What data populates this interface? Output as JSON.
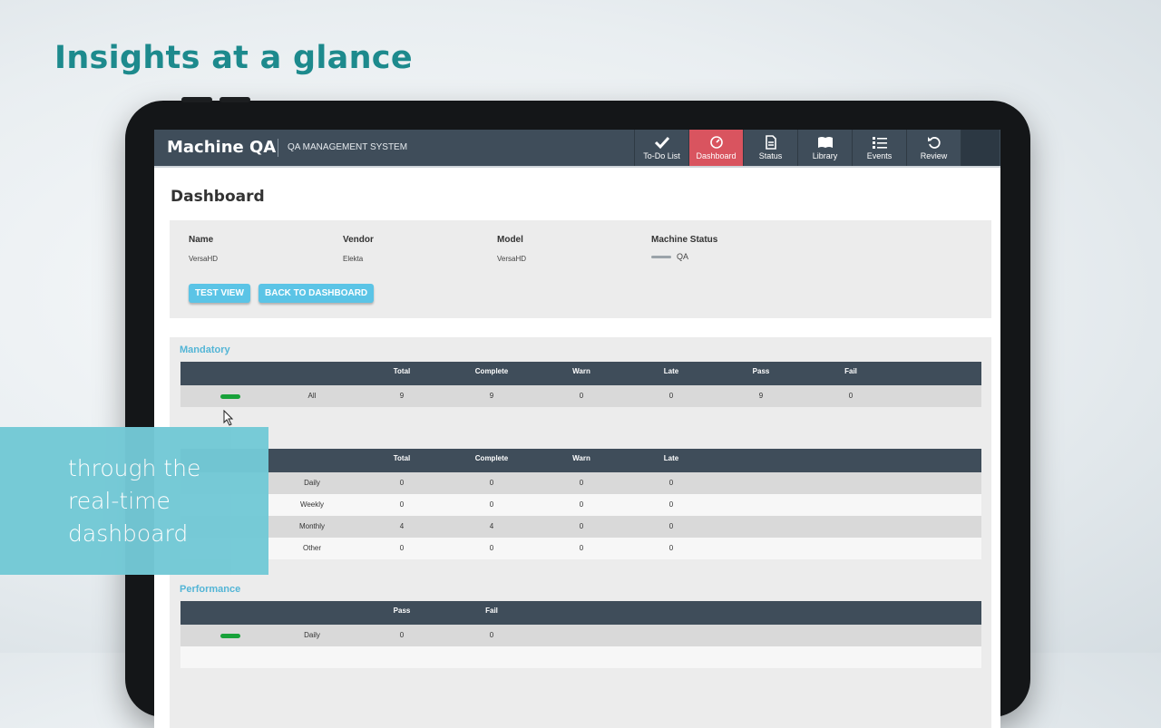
{
  "headline": "Insights at a glance",
  "app": {
    "brand": "Machine QA",
    "subtitle": "QA MANAGEMENT SYSTEM",
    "nav": [
      {
        "label": "To-Do List",
        "icon": "checkmark-icon"
      },
      {
        "label": "Dashboard",
        "icon": "gauge-icon",
        "active": true
      },
      {
        "label": "Status",
        "icon": "document-icon"
      },
      {
        "label": "Library",
        "icon": "book-icon"
      },
      {
        "label": "Events",
        "icon": "list-icon"
      },
      {
        "label": "Review",
        "icon": "undo-icon"
      }
    ]
  },
  "page": {
    "title": "Dashboard"
  },
  "machine": {
    "name_label": "Name",
    "name": "VersaHD",
    "vendor_label": "Vendor",
    "vendor": "Elekta",
    "model_label": "Model",
    "model": "VersaHD",
    "status_label": "Machine Status",
    "status": "QA"
  },
  "buttons": {
    "test_view": "TEST VIEW",
    "back": "BACK TO DASHBOARD"
  },
  "mandatory": {
    "title": "Mandatory",
    "headers": [
      "Total",
      "Complete",
      "Warn",
      "Late",
      "Pass",
      "Fail"
    ],
    "row": {
      "label": "All",
      "values": [
        "9",
        "9",
        "0",
        "0",
        "9",
        "0"
      ]
    }
  },
  "schedule": {
    "headers": [
      "Total",
      "Complete",
      "Warn",
      "Late"
    ],
    "rows": [
      {
        "label": "Daily",
        "values": [
          "0",
          "0",
          "0",
          "0"
        ]
      },
      {
        "label": "Weekly",
        "values": [
          "0",
          "0",
          "0",
          "0"
        ]
      },
      {
        "label": "Monthly",
        "values": [
          "4",
          "4",
          "0",
          "0"
        ]
      },
      {
        "label": "Other",
        "values": [
          "0",
          "0",
          "0",
          "0"
        ]
      }
    ]
  },
  "performance": {
    "title": "Performance",
    "headers": [
      "Pass",
      "Fail"
    ],
    "row": {
      "label": "Daily",
      "values": [
        "0",
        "0"
      ]
    }
  },
  "caption": "through the\nreal-time\ndashboard",
  "colors": {
    "accent": "#1d8a8d",
    "nav_bg": "#3f4d5a",
    "active_tab": "#d9545f",
    "button": "#5bc4e6",
    "status_ok": "#18a23a"
  }
}
